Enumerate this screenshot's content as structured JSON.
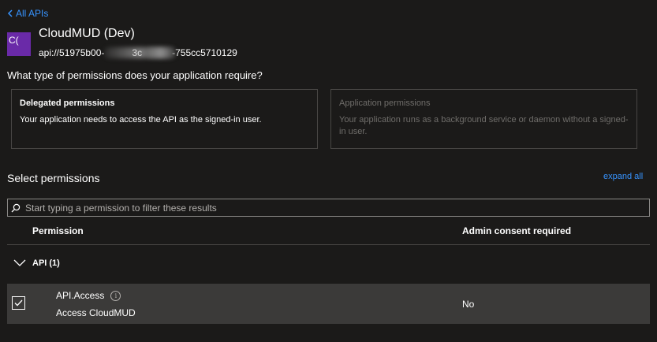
{
  "nav": {
    "back_label": "All APIs"
  },
  "api": {
    "icon_text": "C(",
    "name": "CloudMUD (Dev)",
    "id_prefix": "api://51975b00-",
    "id_mid": "3c",
    "id_suffix": "-755cc5710129"
  },
  "question": "What type of permissions does your application require?",
  "permission_types": {
    "delegated": {
      "title": "Delegated permissions",
      "description": "Your application needs to access the API as the signed-in user."
    },
    "application": {
      "title": "Application permissions",
      "description": "Your application runs as a background service or daemon without a signed-in user."
    }
  },
  "select": {
    "title": "Select permissions",
    "expand_all": "expand all",
    "search_placeholder": "Start typing a permission to filter these results"
  },
  "table": {
    "columns": {
      "permission": "Permission",
      "admin_consent": "Admin consent required"
    },
    "group": {
      "label": "API (1)"
    },
    "rows": [
      {
        "name": "API.Access",
        "description": "Access CloudMUD",
        "admin_consent": "No",
        "checked": true
      }
    ]
  },
  "colors": {
    "accent": "#3794ff",
    "background": "#1b1a19",
    "row_selected": "#3b3a39",
    "icon_purple": "#6a2aa8"
  },
  "icons": [
    "chevron-left-icon",
    "search-icon",
    "chevron-down-icon",
    "checkmark-icon",
    "info-icon"
  ]
}
